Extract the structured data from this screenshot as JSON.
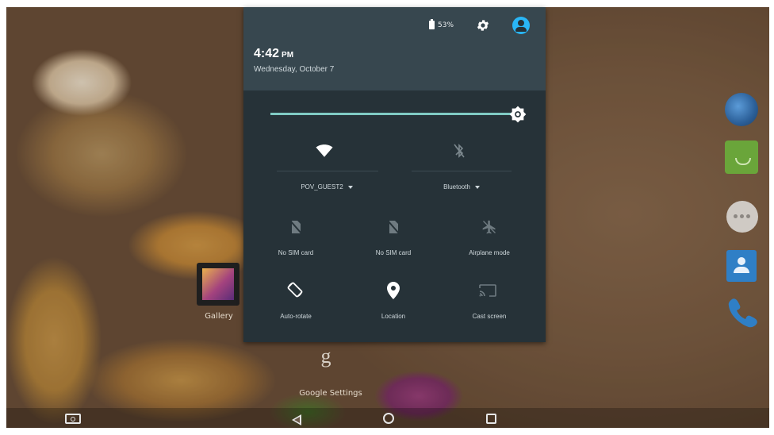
{
  "status": {
    "battery_percent": "53%",
    "time": "4:42",
    "time_suffix": "PM",
    "date": "Wednesday, October 7"
  },
  "quick_settings": {
    "brightness_level": 1.0,
    "wifi": {
      "label": "POV_GUEST2",
      "state": "on",
      "icon": "wifi-icon"
    },
    "bluetooth": {
      "label": "Bluetooth",
      "state": "off",
      "icon": "bluetooth-off-icon"
    },
    "tiles": [
      {
        "label": "No SIM card",
        "icon": "no-sim-icon"
      },
      {
        "label": "No SIM card",
        "icon": "no-sim-icon"
      },
      {
        "label": "Airplane mode",
        "icon": "airplane-icon"
      },
      {
        "label": "Auto-rotate",
        "icon": "rotate-icon"
      },
      {
        "label": "Location",
        "icon": "location-pin-icon"
      },
      {
        "label": "Cast screen",
        "icon": "cast-icon"
      }
    ]
  },
  "homescreen": {
    "gallery_label": "Gallery",
    "google_settings_label": "Google Settings"
  },
  "colors": {
    "shade_bg": "#263238",
    "header_bg": "#37474f",
    "accent": "#80cbc4",
    "avatar": "#29b6f6"
  }
}
